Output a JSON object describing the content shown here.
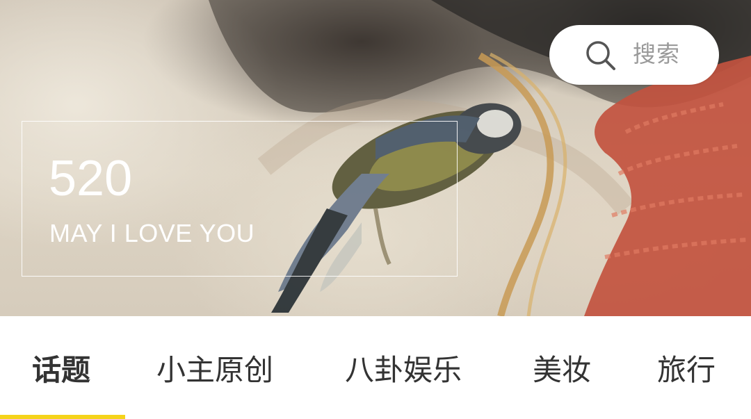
{
  "search": {
    "icon": "search-icon",
    "placeholder": "搜索"
  },
  "banner": {
    "title": "520",
    "subtitle": "MAY I LOVE YOU"
  },
  "tabs": [
    {
      "label": "话题",
      "active": true
    },
    {
      "label": "小主原创",
      "active": false
    },
    {
      "label": "八卦娱乐",
      "active": false
    },
    {
      "label": "美妆",
      "active": false
    },
    {
      "label": "旅行",
      "active": false
    }
  ],
  "colors": {
    "indicator": "#f5d31a",
    "tab_text": "#333333",
    "placeholder_text": "#9a9a9a"
  }
}
